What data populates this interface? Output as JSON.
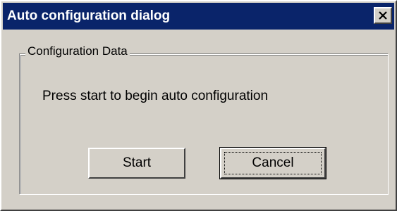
{
  "dialog": {
    "title": "Auto configuration dialog",
    "close_icon": "close-icon",
    "group_label": "Configuration Data",
    "message": "Press start to begin auto configuration",
    "buttons": {
      "start_label": "Start",
      "cancel_label": "Cancel"
    }
  },
  "colors": {
    "titlebar": "#0a246a",
    "face": "#d4d0c8"
  }
}
